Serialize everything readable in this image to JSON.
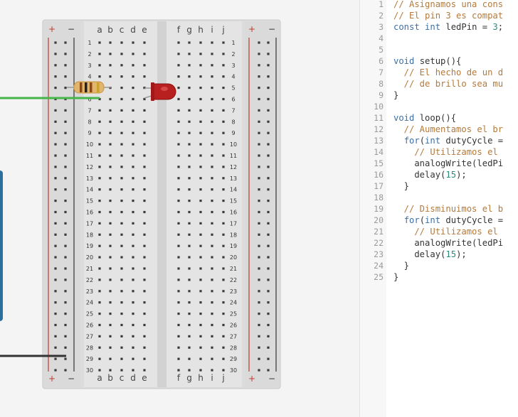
{
  "breadboard": {
    "rail_plus": "+",
    "rail_minus": "−",
    "columns_left": [
      "a",
      "b",
      "c",
      "d",
      "e"
    ],
    "columns_right": [
      "f",
      "g",
      "h",
      "i",
      "j"
    ],
    "row_numbers": [
      "1",
      "2",
      "3",
      "4",
      "5",
      "6",
      "7",
      "8",
      "9",
      "10",
      "11",
      "12",
      "13",
      "14",
      "15",
      "16",
      "17",
      "18",
      "19",
      "20",
      "21",
      "22",
      "23",
      "24",
      "25",
      "26",
      "27",
      "28",
      "29",
      "30"
    ]
  },
  "components": {
    "resistor": "resistor",
    "led": "red-led",
    "wire_green_color": "#46b549",
    "wire_black_color": "#333333",
    "arduino_color": "#2b6f9e"
  },
  "code": {
    "lines": [
      {
        "n": "1",
        "tokens": [
          {
            "t": "// Asignamos una cons",
            "c": "comment"
          }
        ]
      },
      {
        "n": "2",
        "tokens": [
          {
            "t": "// El pin 3 es compat",
            "c": "comment"
          }
        ]
      },
      {
        "n": "3",
        "tokens": [
          {
            "t": "const int",
            "c": "keyword"
          },
          {
            "t": " ledPin = ",
            "c": "plain"
          },
          {
            "t": "3",
            "c": "number"
          },
          {
            "t": ";",
            "c": "plain"
          }
        ]
      },
      {
        "n": "4",
        "tokens": []
      },
      {
        "n": "5",
        "tokens": []
      },
      {
        "n": "6",
        "tokens": [
          {
            "t": "void",
            "c": "keyword"
          },
          {
            "t": " setup(){",
            "c": "plain"
          }
        ]
      },
      {
        "n": "7",
        "tokens": [
          {
            "t": "  // El hecho de un d",
            "c": "comment"
          }
        ]
      },
      {
        "n": "8",
        "tokens": [
          {
            "t": "  // de brillo sea mu",
            "c": "comment"
          }
        ]
      },
      {
        "n": "9",
        "tokens": [
          {
            "t": "}",
            "c": "plain"
          }
        ]
      },
      {
        "n": "10",
        "tokens": []
      },
      {
        "n": "11",
        "tokens": [
          {
            "t": "void",
            "c": "keyword"
          },
          {
            "t": " loop(){",
            "c": "plain"
          }
        ]
      },
      {
        "n": "12",
        "tokens": [
          {
            "t": "  // Aumentamos el br",
            "c": "comment"
          }
        ]
      },
      {
        "n": "13",
        "tokens": [
          {
            "t": "  ",
            "c": "plain"
          },
          {
            "t": "for",
            "c": "keyword"
          },
          {
            "t": "(",
            "c": "plain"
          },
          {
            "t": "int",
            "c": "keyword"
          },
          {
            "t": " dutyCycle =",
            "c": "plain"
          }
        ]
      },
      {
        "n": "14",
        "tokens": [
          {
            "t": "    // Utilizamos el",
            "c": "comment"
          }
        ]
      },
      {
        "n": "15",
        "tokens": [
          {
            "t": "    analogWrite(ledPi",
            "c": "plain"
          }
        ]
      },
      {
        "n": "16",
        "tokens": [
          {
            "t": "    delay(",
            "c": "plain"
          },
          {
            "t": "15",
            "c": "number"
          },
          {
            "t": ");",
            "c": "plain"
          }
        ]
      },
      {
        "n": "17",
        "tokens": [
          {
            "t": "  }",
            "c": "plain"
          }
        ]
      },
      {
        "n": "18",
        "tokens": []
      },
      {
        "n": "19",
        "tokens": [
          {
            "t": "  // Disminuimos el b",
            "c": "comment"
          }
        ]
      },
      {
        "n": "20",
        "tokens": [
          {
            "t": "  ",
            "c": "plain"
          },
          {
            "t": "for",
            "c": "keyword"
          },
          {
            "t": "(",
            "c": "plain"
          },
          {
            "t": "int",
            "c": "keyword"
          },
          {
            "t": " dutyCycle =",
            "c": "plain"
          }
        ]
      },
      {
        "n": "21",
        "tokens": [
          {
            "t": "    // Utilizamos el",
            "c": "comment"
          }
        ]
      },
      {
        "n": "22",
        "tokens": [
          {
            "t": "    analogWrite(ledPi",
            "c": "plain"
          }
        ]
      },
      {
        "n": "23",
        "tokens": [
          {
            "t": "    delay(",
            "c": "plain"
          },
          {
            "t": "15",
            "c": "number"
          },
          {
            "t": ");",
            "c": "plain"
          }
        ]
      },
      {
        "n": "24",
        "tokens": [
          {
            "t": "  }",
            "c": "plain"
          }
        ]
      },
      {
        "n": "25",
        "tokens": [
          {
            "t": "}",
            "c": "plain"
          }
        ]
      }
    ]
  }
}
